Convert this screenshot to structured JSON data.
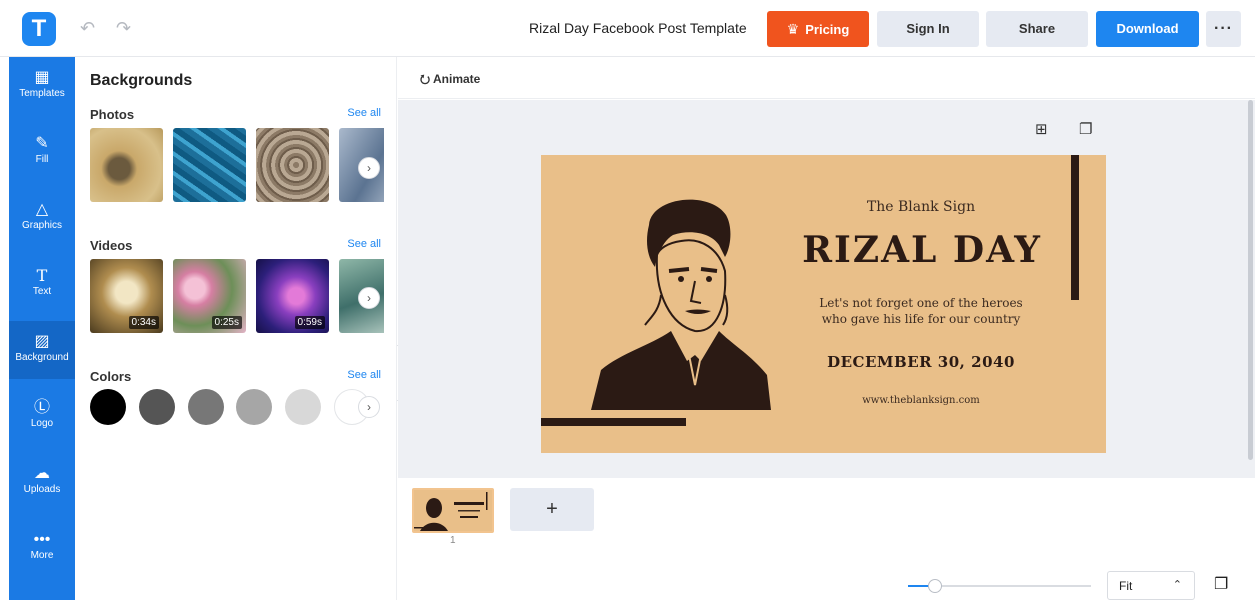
{
  "app": {
    "logo_letter": "T"
  },
  "header": {
    "undo_icon": "undo-icon",
    "redo_icon": "redo-icon",
    "title": "Rizal Day Facebook Post Template",
    "pricing_label": "Pricing",
    "signin_label": "Sign In",
    "share_label": "Share",
    "download_label": "Download",
    "more_label": "···",
    "colors": {
      "pricing": "#f0541e",
      "download": "#1e86f0",
      "rail": "#1b7ae4"
    }
  },
  "rail": {
    "items": [
      {
        "label": "Templates",
        "icon": "templates-icon"
      },
      {
        "label": "Fill",
        "icon": "pencil-icon"
      },
      {
        "label": "Graphics",
        "icon": "shapes-icon"
      },
      {
        "label": "Text",
        "icon": "text-icon"
      },
      {
        "label": "Background",
        "icon": "background-icon"
      },
      {
        "label": "Logo",
        "icon": "logo-icon"
      },
      {
        "label": "Uploads",
        "icon": "upload-icon"
      },
      {
        "label": "More",
        "icon": "more-icon"
      }
    ],
    "active": "Background"
  },
  "panel": {
    "title": "Backgrounds",
    "photos": {
      "title": "Photos",
      "see_all": "See all"
    },
    "videos": {
      "title": "Videos",
      "see_all": "See all",
      "durations": [
        "0:34s",
        "0:25s",
        "0:59s"
      ]
    },
    "colors": {
      "title": "Colors",
      "see_all": "See all",
      "swatches": [
        "#000000",
        "#555555",
        "#777777",
        "#a6a6a6",
        "#d8d8d8",
        "#ffffff"
      ]
    }
  },
  "canvas": {
    "animate_label": "Animate",
    "design": {
      "brand": "The Blank Sign",
      "title": "RIZAL DAY",
      "subtitle_line1": "Let's not forget one of the heroes",
      "subtitle_line2": "who gave his life for our country",
      "date": "DECEMBER 30, 2040",
      "url": "www.theblanksign.com",
      "bg_color": "#e9bf89",
      "ink_color": "#2b1a14"
    }
  },
  "pages": {
    "page_number": "1",
    "add_label": "+",
    "zoom_label": "Fit",
    "zoom_level": 0.15
  }
}
